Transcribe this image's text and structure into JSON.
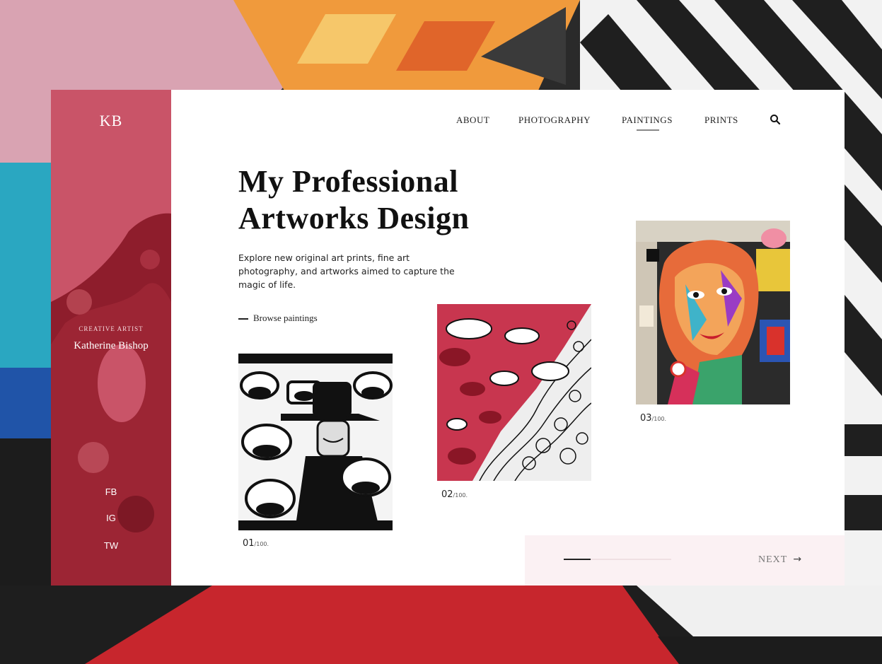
{
  "brand": {
    "logo": "KB",
    "role": "CREATIVE ARTIST",
    "name": "Katherine Bishop"
  },
  "nav": {
    "items": [
      "ABOUT",
      "PHOTOGRAPHY",
      "PAINTINGS",
      "PRINTS"
    ],
    "active": "PAINTINGS",
    "search_icon": "search-icon"
  },
  "hero": {
    "title_line1": "My Professional",
    "title_line2": "Artworks Design",
    "description": "Explore new original art prints, fine art photography, and artworks aimed to capture the magic of life.",
    "browse_label": "Browse paintings"
  },
  "artworks": [
    {
      "number": "01",
      "total": "/100."
    },
    {
      "number": "02",
      "total": "/100."
    },
    {
      "number": "03",
      "total": "/100."
    }
  ],
  "social": [
    "FB",
    "IG",
    "TW"
  ],
  "pager": {
    "next_label": "NEXT",
    "progress": 0.25
  },
  "colors": {
    "accent": "#c95468",
    "sidebar_dark": "#8e1d2c",
    "pager_bg": "#fbf1f3"
  }
}
